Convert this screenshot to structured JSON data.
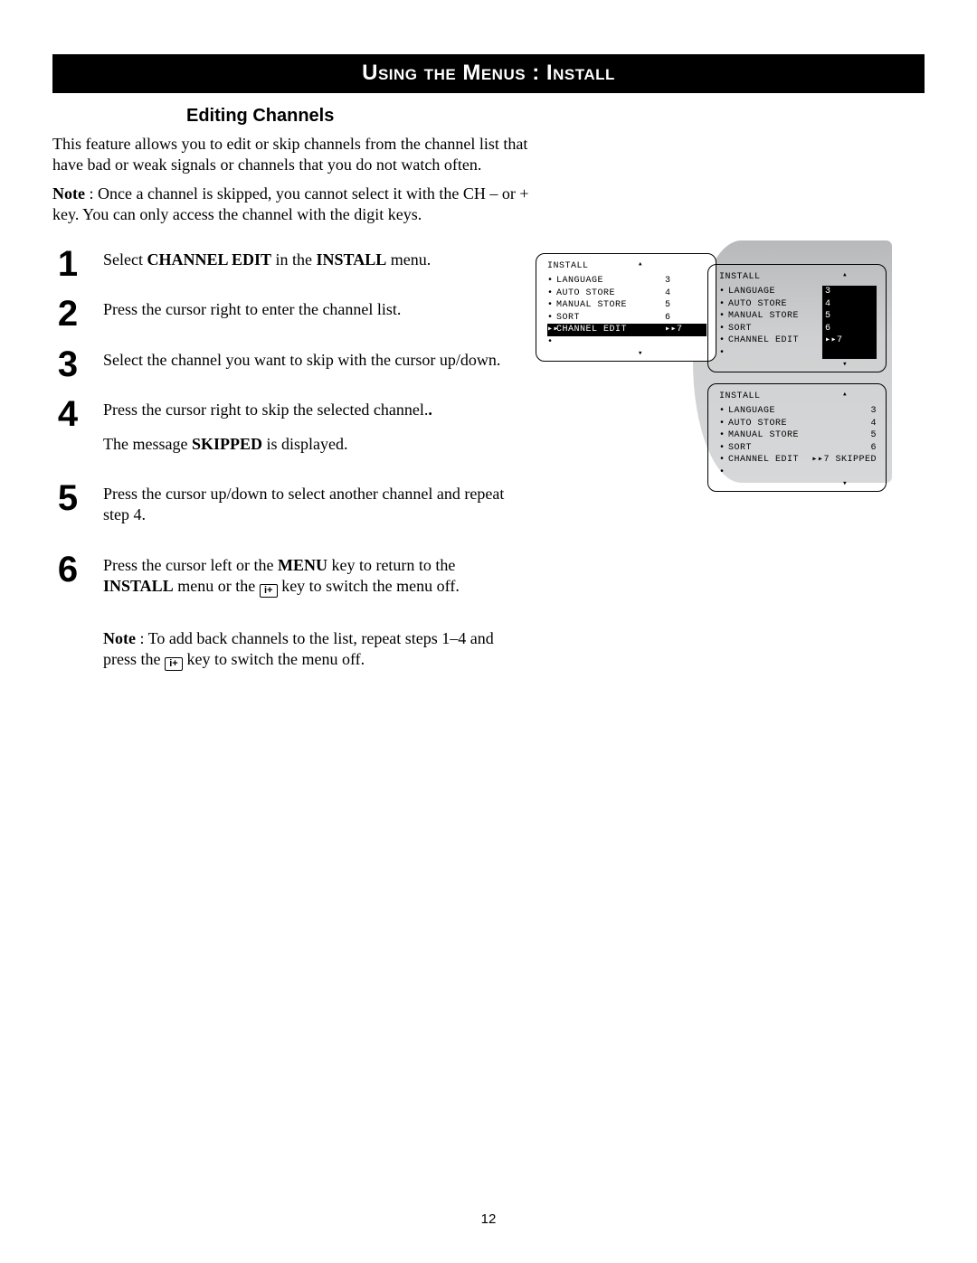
{
  "banner": "Using the Menus : Install",
  "subheading": "Editing Channels",
  "intro": "This feature allows you to edit or skip channels from the channel list that have bad or weak signals or channels that you do not watch often.",
  "note_label": "Note",
  "note_body": " : Once a channel is skipped, you cannot select it with the CH – or + key. You can only access the channel with the digit keys.",
  "steps": {
    "s1": {
      "num": "1",
      "pre": "Select ",
      "b1": "CHANNEL EDIT",
      "mid": " in the ",
      "b2": "INSTALL",
      "post": " menu."
    },
    "s2": {
      "num": "2",
      "text": "Press the cursor right to enter the channel list."
    },
    "s3": {
      "num": "3",
      "text": "Select the channel you want to skip with the cursor up/down."
    },
    "s4": {
      "num": "4",
      "line1": "Press the cursor right to skip the selected channel.",
      "line2a": "The message ",
      "line2b": "SKIPPED",
      "line2c": " is displayed."
    },
    "s5": {
      "num": "5",
      "text": "Press the cursor up/down to select another channel and repeat step 4."
    },
    "s6": {
      "num": "6",
      "pre": "Press the cursor left or the ",
      "b1": "MENU",
      "mid": " key to return to the ",
      "b2": "INSTALL",
      "mid2": " menu or the ",
      "post": " key to switch the menu off."
    }
  },
  "extra_note": {
    "label": "Note",
    "pre": " : To add back channels to the list, repeat steps 1–4 and press the ",
    "post": " key to switch the menu off."
  },
  "info_icon_text": "i+",
  "menu": {
    "title": "INSTALL",
    "items": [
      {
        "label": "LANGUAGE",
        "val": "3"
      },
      {
        "label": "AUTO STORE",
        "val": "4"
      },
      {
        "label": "MANUAL STORE",
        "val": "5"
      },
      {
        "label": "SORT",
        "val": "6"
      },
      {
        "label": "CHANNEL EDIT",
        "val": "7"
      }
    ],
    "skipped": "SKIPPED",
    "arrow": "▸▸"
  },
  "page_number": "12"
}
